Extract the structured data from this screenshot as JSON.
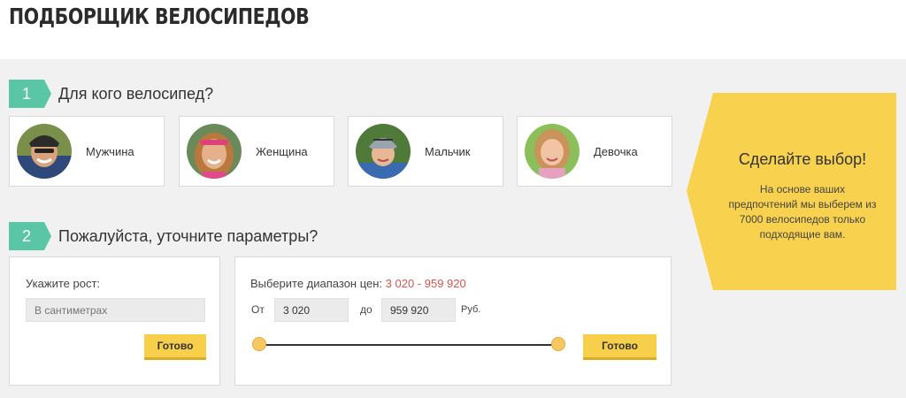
{
  "page": {
    "title": "ПОДБОРЩИК ВЕЛОСИПЕДОВ"
  },
  "colors": {
    "accent_green": "#5ac6a6",
    "accent_yellow": "#f7cf4a",
    "banner_yellow": "#f8d24e",
    "price_red": "#d9534f"
  },
  "step1": {
    "number": "1",
    "label": "Для кого велосипед?",
    "options": [
      {
        "label": "Мужчина",
        "icon": "man-avatar"
      },
      {
        "label": "Женщина",
        "icon": "woman-avatar"
      },
      {
        "label": "Мальчик",
        "icon": "boy-avatar"
      },
      {
        "label": "Девочка",
        "icon": "girl-avatar"
      }
    ]
  },
  "step2": {
    "number": "2",
    "label": "Пожалуйста, уточните параметры?",
    "height": {
      "label": "Укажите рост:",
      "placeholder": "В сантиметрах",
      "button": "Готово"
    },
    "price": {
      "label": "Выберите диапазон цен:",
      "range_text": "3 020 - 959 920",
      "from_label": "От",
      "from_value": "3 020",
      "to_label": "до",
      "to_value": "959 920",
      "currency": "Руб.",
      "button": "Готово"
    }
  },
  "banner": {
    "title": "Сделайте выбор!",
    "text": "На основе ваших предпочтений мы выберем из 7000 велосипедов только подходящие вам."
  }
}
